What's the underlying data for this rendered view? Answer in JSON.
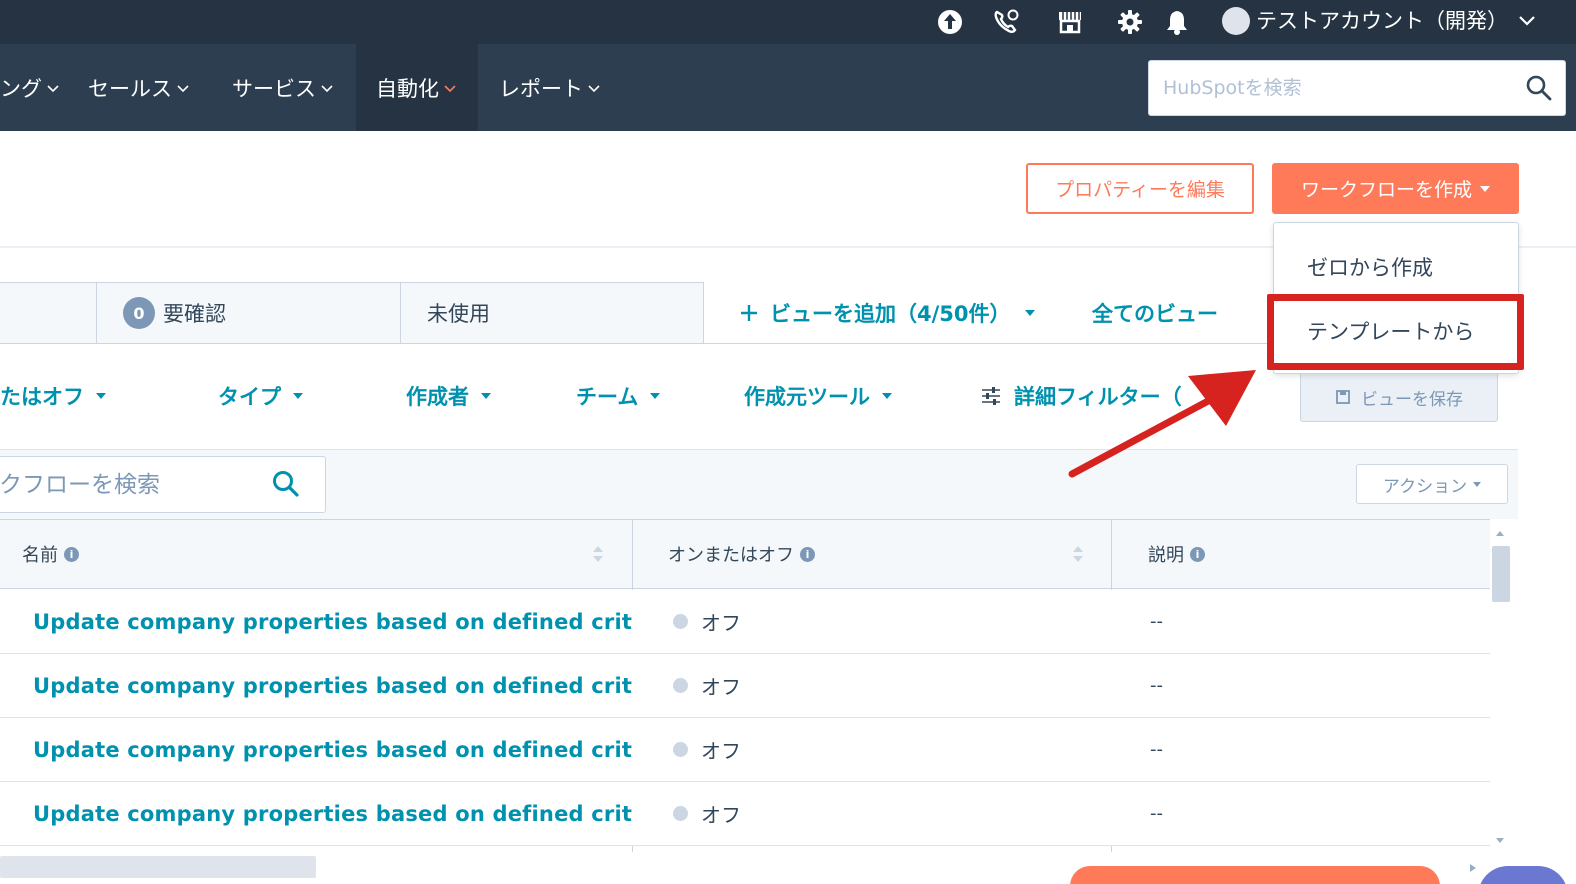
{
  "topbar": {
    "account_name": "テストアカウント（開発）"
  },
  "nav": {
    "items": [
      {
        "label": "ング"
      },
      {
        "label": "セールス"
      },
      {
        "label": "サービス"
      },
      {
        "label": "自動化",
        "active": true
      },
      {
        "label": "レポート"
      }
    ],
    "search_placeholder": "HubSpotを検索"
  },
  "header": {
    "edit_properties_label": "プロパティーを編集",
    "create_workflow_label": "ワークフローを作成"
  },
  "dropdown": {
    "items": [
      {
        "label": "ゼロから作成"
      },
      {
        "label": "テンプレートから",
        "highlighted": true
      }
    ]
  },
  "view_tabs": {
    "tabs": [
      {
        "label": "要確認",
        "badge": "0"
      },
      {
        "label": "未使用"
      }
    ],
    "add_view_label": "ビューを追加（4/50件）",
    "all_views_label": "全てのビュー"
  },
  "filters": {
    "items": [
      {
        "label": "たはオフ"
      },
      {
        "label": "タイプ"
      },
      {
        "label": "作成者"
      },
      {
        "label": "チーム"
      },
      {
        "label": "作成元ツール"
      }
    ],
    "advanced_label": "詳細フィルター（",
    "save_view_label": "ビューを保存"
  },
  "table_toolbar": {
    "search_placeholder": "クフローを検索",
    "actions_label": "アクション"
  },
  "table": {
    "columns": [
      {
        "label": "名前"
      },
      {
        "label": "オンまたはオフ"
      },
      {
        "label": "説明"
      }
    ],
    "rows": [
      {
        "name": "Update company properties based on defined crit",
        "status": "オフ",
        "description": "--"
      },
      {
        "name": "Update company properties based on defined crit",
        "status": "オフ",
        "description": "--"
      },
      {
        "name": "Update company properties based on defined crit",
        "status": "オフ",
        "description": "--"
      },
      {
        "name": "Update company properties based on defined crit",
        "status": "オフ",
        "description": "--"
      }
    ]
  },
  "colors": {
    "accent": "#ff7a59",
    "link": "#0091ae",
    "nav_bg": "#2d3e50",
    "highlight": "#d6231f"
  }
}
